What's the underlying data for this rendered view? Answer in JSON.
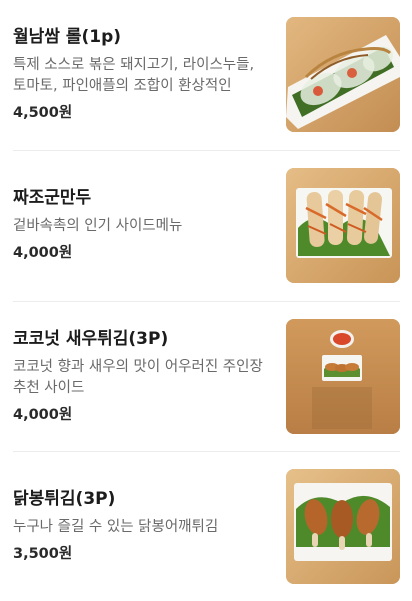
{
  "menu": {
    "items": [
      {
        "name": "월남쌈 롤(1p)",
        "description": "특제 소스로 볶은 돼지고기, 라이스누들, 토마토, 파인애플의 조합이 환상적인",
        "price": "4,500원",
        "image_icon": "spring-roll-photo"
      },
      {
        "name": "짜조군만두",
        "description": "겉바속촉의 인기 사이드메뉴",
        "price": "4,000원",
        "image_icon": "fried-spring-roll-photo"
      },
      {
        "name": "코코넛 새우튀김(3P)",
        "description": "코코넛 향과 새우의 맛이 어우러진 주인장 추천 사이드",
        "price": "4,000원",
        "image_icon": "coconut-shrimp-photo"
      },
      {
        "name": "닭봉튀김(3P)",
        "description": "누구나 즐길 수 있는 닭봉어깨튀김",
        "price": "3,500원",
        "image_icon": "fried-chicken-wing-photo"
      }
    ]
  },
  "colors": {
    "wood": "#d8a76a",
    "wood_dark": "#c48f55",
    "plate": "#f7f7f5",
    "lettuce": "#5b8f2e",
    "fried": "#c9863b",
    "sauce": "#c0392b"
  }
}
